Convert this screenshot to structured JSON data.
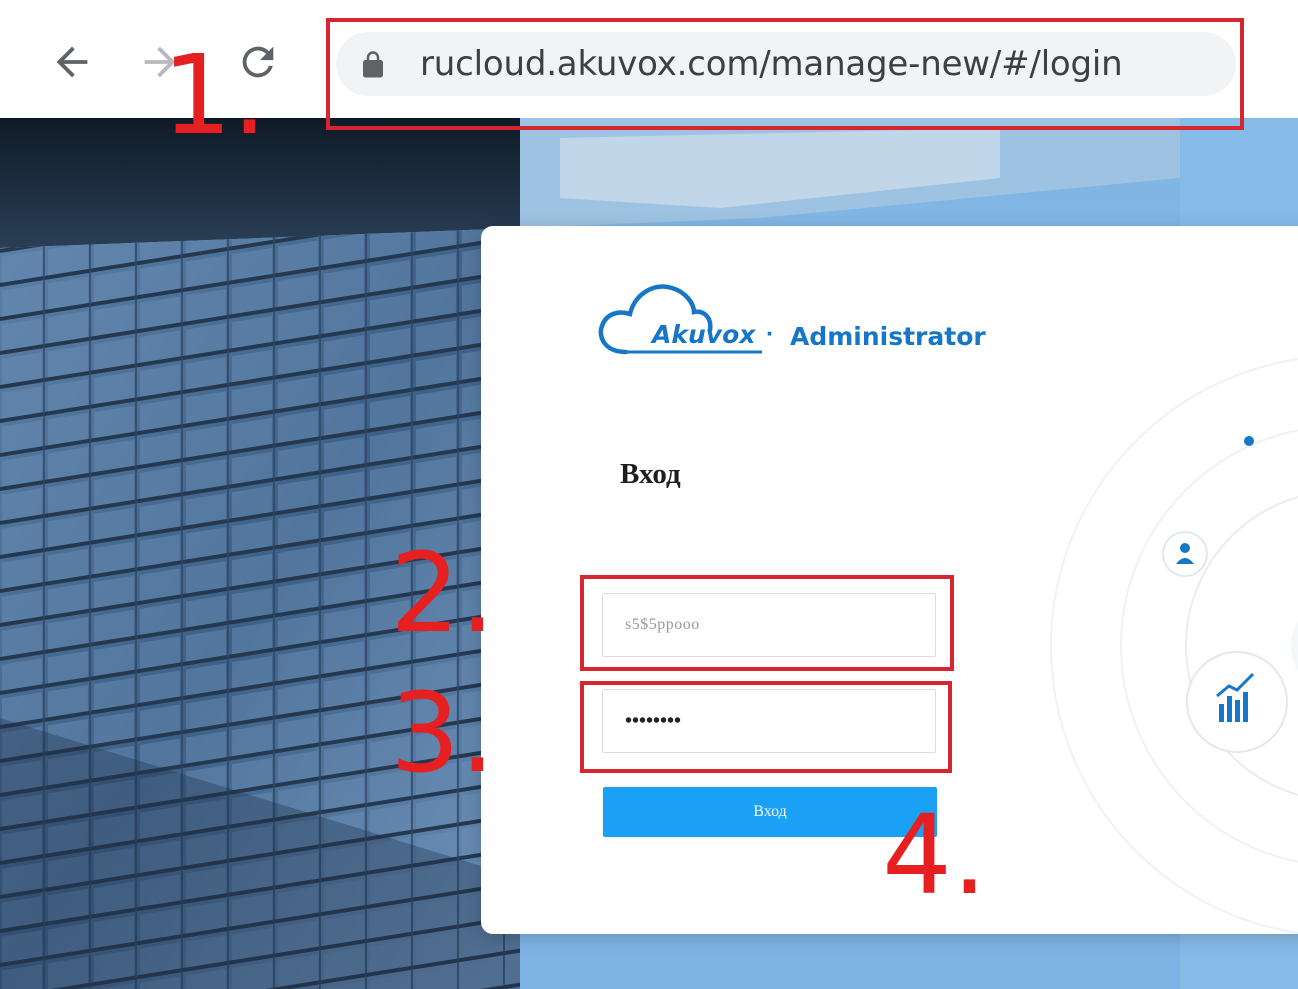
{
  "browser": {
    "url": "rucloud.akuvox.com/manage-new/#/login",
    "icons": [
      "back-arrow-icon",
      "forward-arrow-icon",
      "reload-icon",
      "lock-icon"
    ]
  },
  "login": {
    "brand": "Akuvox",
    "brand_suffix": "Administrator",
    "title": "Вход",
    "username_value": "s5$5ppooo",
    "password_value": "••••••••",
    "button_label": "Вход"
  },
  "annotations": {
    "numbers": [
      "1.",
      "2.",
      "3.",
      "4."
    ],
    "color": "#d7262f"
  },
  "colors": {
    "accent": "#1677c9",
    "button": "#1aa0f5",
    "annotation": "#e62020"
  }
}
